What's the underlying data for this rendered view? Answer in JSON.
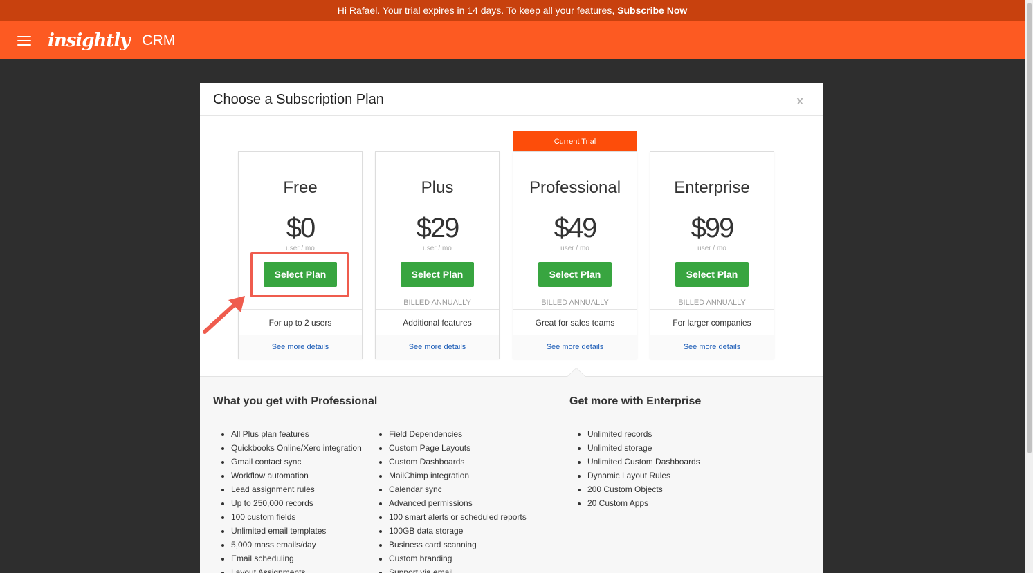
{
  "banner": {
    "text": "Hi Rafael. Your trial expires in 14 days. To keep all your features, ",
    "link": "Subscribe Now"
  },
  "topbar": {
    "logo": "insightly",
    "product": "CRM"
  },
  "modal": {
    "title": "Choose a Subscription Plan",
    "close": "x"
  },
  "plans": [
    {
      "name": "Free",
      "price": "$0",
      "unit": "user / mo",
      "button": "Select Plan",
      "billed": "",
      "description": "For up to 2 users",
      "details": "See more details"
    },
    {
      "name": "Plus",
      "price": "$29",
      "unit": "user / mo",
      "button": "Select Plan",
      "billed": "BILLED ANNUALLY",
      "description": "Additional features",
      "details": "See more details"
    },
    {
      "name": "Professional",
      "price": "$49",
      "unit": "user / mo",
      "button": "Select Plan",
      "billed": "BILLED ANNUALLY",
      "description": "Great for sales teams",
      "details": "See more details",
      "badge": "Current Trial"
    },
    {
      "name": "Enterprise",
      "price": "$99",
      "unit": "user / mo",
      "button": "Select Plan",
      "billed": "BILLED ANNUALLY",
      "description": "For larger companies",
      "details": "See more details"
    }
  ],
  "professional_features": {
    "heading": "What you get with Professional",
    "col1": [
      "All Plus plan features",
      "Quickbooks Online/Xero integration",
      "Gmail contact sync",
      "Workflow automation",
      "Lead assignment rules",
      "Up to 250,000 records",
      "100 custom fields",
      "Unlimited email templates",
      "5,000 mass emails/day",
      "Email scheduling",
      "Layout Assignments"
    ],
    "col2": [
      "Field Dependencies",
      "Custom Page Layouts",
      "Custom Dashboards",
      "MailChimp integration",
      "Calendar sync",
      "Advanced permissions",
      "100 smart alerts or scheduled reports",
      "100GB data storage",
      "Business card scanning",
      "Custom branding",
      "Support via email"
    ]
  },
  "enterprise_features": {
    "heading": "Get more with Enterprise",
    "items": [
      "Unlimited records",
      "Unlimited storage",
      "Unlimited Custom Dashboards",
      "Dynamic Layout Rules",
      "200 Custom Objects",
      "20 Custom Apps"
    ]
  },
  "colors": {
    "banner": "#c8410e",
    "topbar": "#fd5a22",
    "select_button": "#38a540",
    "current_trial": "#fd4d0a",
    "annotation": "#ef5c4e",
    "link": "#1f5fb8"
  },
  "icons": {
    "menu": "hamburger-icon",
    "annotation": "arrow-annotation"
  }
}
